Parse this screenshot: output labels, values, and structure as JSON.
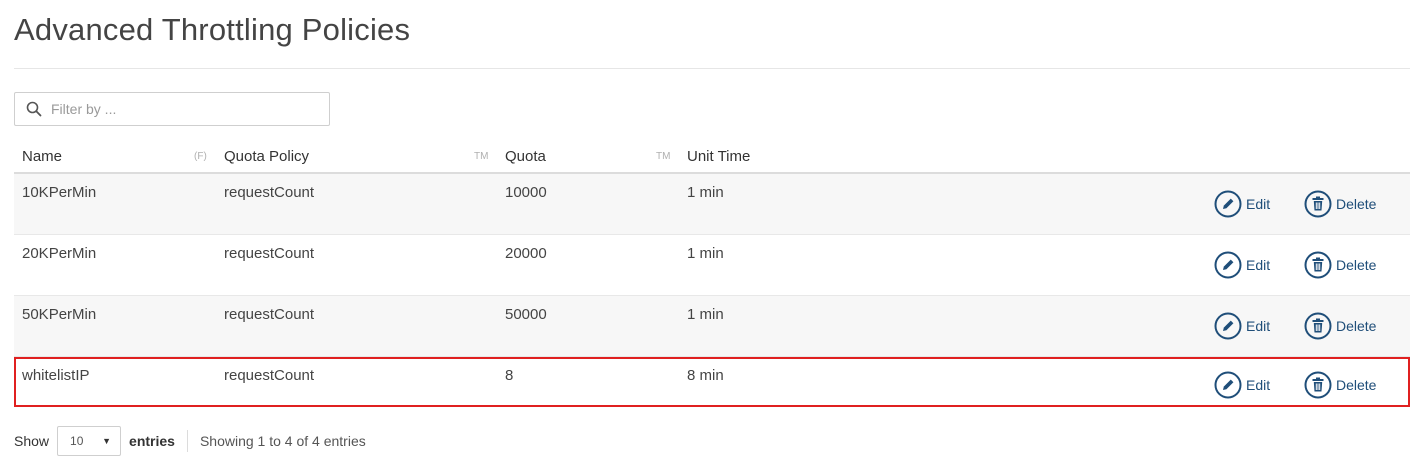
{
  "page": {
    "title": "Advanced Throttling Policies"
  },
  "filter": {
    "placeholder": "Filter by ..."
  },
  "table": {
    "headers": {
      "name": "Name",
      "name_sort": "(F)",
      "quota_policy": "Quota Policy",
      "quota_policy_sort": "TM",
      "quota": "Quota",
      "quota_sort": "TM",
      "unit_time": "Unit Time"
    },
    "rows": [
      {
        "name": "10KPerMin",
        "quota_policy": "requestCount",
        "quota": "10000",
        "unit_time": "1 min",
        "edit_label": "Edit",
        "delete_label": "Delete"
      },
      {
        "name": "20KPerMin",
        "quota_policy": "requestCount",
        "quota": "20000",
        "unit_time": "1 min",
        "edit_label": "Edit",
        "delete_label": "Delete"
      },
      {
        "name": "50KPerMin",
        "quota_policy": "requestCount",
        "quota": "50000",
        "unit_time": "1 min",
        "edit_label": "Edit",
        "delete_label": "Delete"
      },
      {
        "name": "whitelistIP",
        "quota_policy": "requestCount",
        "quota": "8",
        "unit_time": "8 min",
        "edit_label": "Edit",
        "delete_label": "Delete"
      }
    ]
  },
  "footer": {
    "show_label": "Show",
    "page_length": "10",
    "entries_label": "entries",
    "info": "Showing 1 to 4 of 4 entries"
  },
  "colors": {
    "accent": "#1f4e79",
    "highlight_border": "#e02020"
  },
  "icons": {
    "filter": "search-icon",
    "edit": "pencil-icon",
    "delete": "trash-icon",
    "select": "caret-down-icon"
  }
}
